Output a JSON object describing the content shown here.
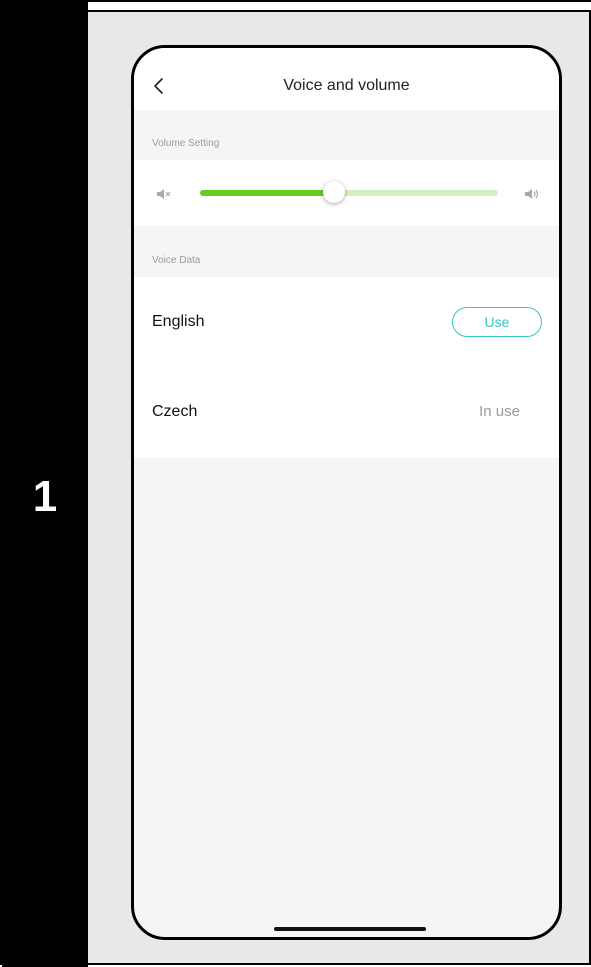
{
  "step": {
    "number": "1"
  },
  "nav": {
    "title": "Voice and volume",
    "back_icon": "chevron-left-icon"
  },
  "volume": {
    "section_label": "Volume Setting",
    "level": 0.45,
    "mute_icon": "speaker-muted-icon",
    "loud_icon": "speaker-loud-icon",
    "fill_color": "#66cc1f",
    "track_color": "#d4efc0"
  },
  "voice": {
    "section_label": "Voice Data",
    "languages": [
      {
        "name": "English",
        "action_label": "Use"
      },
      {
        "name": "Czech",
        "status_label": "In use"
      }
    ],
    "accent_color": "#35c8c0"
  }
}
